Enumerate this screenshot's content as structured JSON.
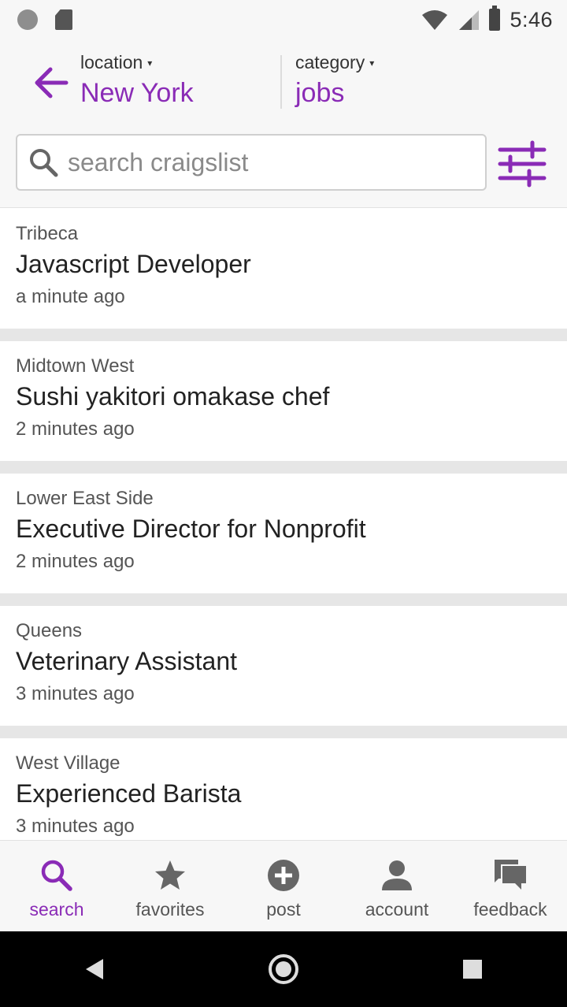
{
  "status_bar": {
    "time": "5:46"
  },
  "header": {
    "location_label": "location",
    "location_value": "New York",
    "category_label": "category",
    "category_value": "jobs",
    "caret": "▾"
  },
  "search": {
    "placeholder": "search craigslist",
    "value": ""
  },
  "colors": {
    "accent": "#8a2bb6",
    "text": "#222222",
    "muted": "#555555",
    "separator": "#e6e6e6"
  },
  "listings": [
    {
      "neighborhood": "Tribeca",
      "title": "Javascript Developer",
      "posted": "a minute ago"
    },
    {
      "neighborhood": "Midtown West",
      "title": "Sushi yakitori omakase chef",
      "posted": "2 minutes ago"
    },
    {
      "neighborhood": "Lower East Side",
      "title": "Executive Director for Nonprofit",
      "posted": "2 minutes ago"
    },
    {
      "neighborhood": "Queens",
      "title": "Veterinary Assistant",
      "posted": "3 minutes ago"
    },
    {
      "neighborhood": "West Village",
      "title": "Experienced Barista",
      "posted": "3 minutes ago"
    }
  ],
  "bottom_nav": [
    {
      "label": "search",
      "icon": "search-icon",
      "active": true
    },
    {
      "label": "favorites",
      "icon": "star-icon",
      "active": false
    },
    {
      "label": "post",
      "icon": "plus-circle-icon",
      "active": false
    },
    {
      "label": "account",
      "icon": "person-icon",
      "active": false
    },
    {
      "label": "feedback",
      "icon": "chat-icon",
      "active": false
    }
  ]
}
